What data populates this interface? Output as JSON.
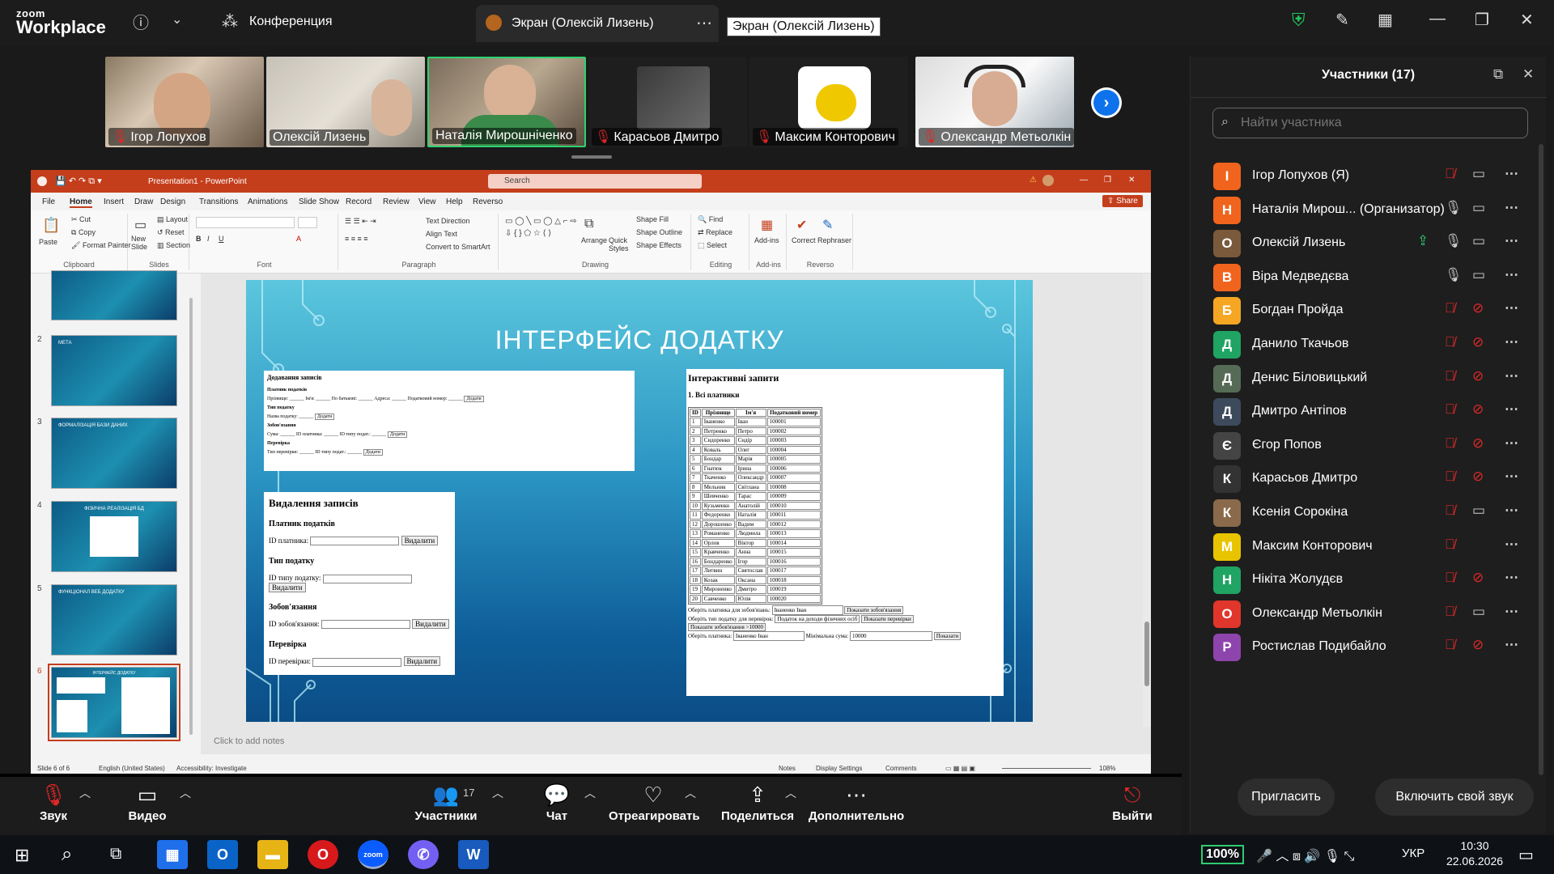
{
  "zoom": {
    "logo": {
      "line1": "zoom",
      "line2": "Workplace"
    },
    "meeting_title": "Конференция",
    "share_tab": "Экран (Олексій Лизень)",
    "tooltip": "Экран (Олексій Лизень)"
  },
  "video_tiles": [
    {
      "name": "Ігор Лопухов",
      "muted": true
    },
    {
      "name": "Олексій Лизень",
      "muted": false
    },
    {
      "name": "Наталія Мирошніченко",
      "muted": false,
      "active": true
    },
    {
      "name": "Карасьов Дмитро",
      "muted": true
    },
    {
      "name": "Максим Конторович",
      "muted": true
    },
    {
      "name": "Олександр Метьолкін",
      "muted": true
    }
  ],
  "ppt": {
    "window_title": "Presentation1 - PowerPoint",
    "search_placeholder": "Search",
    "menu": [
      "File",
      "Home",
      "Insert",
      "Draw",
      "Design",
      "Transitions",
      "Animations",
      "Slide Show",
      "Record",
      "Review",
      "View",
      "Help",
      "Reverso"
    ],
    "share_label": "Share",
    "ribbon": {
      "paste": "Paste",
      "cut": "Cut",
      "copy": "Copy",
      "format_painter": "Format Painter",
      "clipboard": "Clipboard",
      "new_slide": "New Slide",
      "layout": "Layout",
      "reset": "Reset",
      "section": "Section",
      "slides": "Slides",
      "font": "Font",
      "text_direction": "Text Direction",
      "align_text": "Align Text",
      "convert_smartart": "Convert to SmartArt",
      "paragraph": "Paragraph",
      "arrange": "Arrange",
      "quick_styles": "Quick Styles",
      "shape_fill": "Shape Fill",
      "shape_outline": "Shape Outline",
      "shape_effects": "Shape Effects",
      "drawing": "Drawing",
      "find": "Find",
      "replace": "Replace",
      "select": "Select",
      "editing": "Editing",
      "addins": "Add-ins",
      "addins_group": "Add-ins",
      "correct": "Correct",
      "rephraser": "Rephraser",
      "reverso_group": "Reverso"
    },
    "slides": [
      {
        "num": "2",
        "title": "МЕТА"
      },
      {
        "num": "3",
        "title": "ФОРМАЛІЗАЦІЯ БАЗИ ДАНИХ"
      },
      {
        "num": "4",
        "title": "ФІЗИЧНА РЕАЛІЗАЦІЯ БД"
      },
      {
        "num": "5",
        "title": "ФУНКЦІОНАЛ ВЕБ ДОДАТКУ"
      },
      {
        "num": "6",
        "title": "ІНТЕРФЕЙС ДОДАТКУ",
        "selected": true
      }
    ],
    "slide": {
      "title": "ІНТЕРФЕЙС ДОДАТКУ",
      "add_panel": {
        "heading": "Додавання записів",
        "payer": "Платник податків",
        "payer_fields": "Прізвище: ______ Ім'я: ______ По батькові: ______ Адреса: ______ Податковий номер: ______",
        "add_btn": "Додати",
        "tax_type": "Тип податку",
        "tax_field": "Назва податку:",
        "obligation": "Зобов'язання",
        "obligation_fields": "Сума: ______ ID платника: ______ ID типу подат.: ______",
        "check": "Перевірка",
        "check_fields": "Тип перевірки: ______ ID типу подат.: ______"
      },
      "delete_panel": {
        "heading": "Видалення записів",
        "sections": [
          {
            "title": "Платник податків",
            "label": "ID платника:",
            "button": "Видалити"
          },
          {
            "title": "Тип податку",
            "label": "ID типу податку:",
            "button": "Видалити"
          },
          {
            "title": "Зобов'язання",
            "label": "ID зобов'язання:",
            "button": "Видалити"
          },
          {
            "title": "Перевірка",
            "label": "ID перевірки:",
            "button": "Видалити"
          }
        ]
      },
      "query_panel": {
        "heading": "Інтерактивні запити",
        "subheading": "1. Всі платники",
        "columns": [
          "ID",
          "Прізвище",
          "Ім'я",
          "Податковий номер"
        ],
        "rows": [
          [
            "1",
            "Іваненко",
            "Іван",
            "100001"
          ],
          [
            "2",
            "Петренко",
            "Петро",
            "100002"
          ],
          [
            "3",
            "Сидоренко",
            "Сидір",
            "100003"
          ],
          [
            "4",
            "Коваль",
            "Олег",
            "100004"
          ],
          [
            "5",
            "Бондар",
            "Марія",
            "100005"
          ],
          [
            "6",
            "Гнатюк",
            "Ірина",
            "100006"
          ],
          [
            "7",
            "Ткаченко",
            "Олександр",
            "100007"
          ],
          [
            "8",
            "Мельник",
            "Світлана",
            "100008"
          ],
          [
            "9",
            "Шевченко",
            "Тарас",
            "100009"
          ],
          [
            "10",
            "Кузьменко",
            "Анатолій",
            "100010"
          ],
          [
            "11",
            "Федоренко",
            "Наталія",
            "100011"
          ],
          [
            "12",
            "Дорошенко",
            "Вадим",
            "100012"
          ],
          [
            "13",
            "Романенко",
            "Людмила",
            "100013"
          ],
          [
            "14",
            "Орлов",
            "Віктор",
            "100014"
          ],
          [
            "15",
            "Кравченко",
            "Анна",
            "100015"
          ],
          [
            "16",
            "Бондаренко",
            "Ігор",
            "100016"
          ],
          [
            "17",
            "Литвин",
            "Святослав",
            "100017"
          ],
          [
            "18",
            "Козак",
            "Оксана",
            "100018"
          ],
          [
            "19",
            "Мироненко",
            "Дмитро",
            "100019"
          ],
          [
            "20",
            "Савченко",
            "Юлія",
            "100020"
          ]
        ],
        "f1_label": "Оберіть платника для зобов'язань:",
        "f1_value": "Іваненко Іван",
        "f1_btn": "Показати зобов'язання",
        "f2_label": "Оберіть тип податку для перевірок:",
        "f2_value": "Податок на доходи фізичних осіб",
        "f2_btn": "Показати перевірки",
        "f3_btn": "Показати зобов'язання >10000",
        "f4_label": "Оберіть платника:",
        "f4_value": "Іваненко Іван",
        "f4_min": "Мінімальна сума:",
        "f4_min_value": "10000",
        "f4_btn": "Показати"
      }
    },
    "notes_placeholder": "Click to add notes",
    "status": {
      "slide": "Slide 6 of 6",
      "lang": "English (United States)",
      "accessibility": "Accessibility: Investigate",
      "notes": "Notes",
      "display": "Display Settings",
      "comments": "Comments",
      "zoom": "108%"
    }
  },
  "participants": {
    "title": "Участники (17)",
    "search_placeholder": "Найти участника",
    "list": [
      {
        "initial": "І",
        "color": "#f0641e",
        "name": "Ігор Лопухов (Я)",
        "mic": "off",
        "cam": "on"
      },
      {
        "initial": "Н",
        "color": "#f0641e",
        "name": "Наталія Мирош... (Организатор)",
        "mic": "on",
        "cam": "on"
      },
      {
        "initial": "О",
        "color": "#7a5a3a",
        "name": "Олексій Лизень",
        "mic": "on",
        "cam": "on",
        "sharing": true
      },
      {
        "initial": "В",
        "color": "#f0641e",
        "name": "Віра Медведєва",
        "mic": "on",
        "cam": "on"
      },
      {
        "initial": "Б",
        "color": "#f5a623",
        "name": "Богдан Пройда",
        "mic": "off",
        "cam": "off"
      },
      {
        "initial": "Д",
        "color": "#1fa463",
        "name": "Данило Ткачьов",
        "mic": "off",
        "cam": "off"
      },
      {
        "initial": "Д",
        "color": "#556b55",
        "name": "Денис Біловицький",
        "mic": "off",
        "cam": "off"
      },
      {
        "initial": "Д",
        "color": "#3d4a5c",
        "name": "Дмитро Антіпов",
        "mic": "off",
        "cam": "off"
      },
      {
        "initial": "Є",
        "color": "#444",
        "name": "Єгор Попов",
        "mic": "off",
        "cam": "off"
      },
      {
        "initial": "К",
        "color": "#333",
        "name": "Карасьов Дмитро",
        "mic": "off",
        "cam": "off"
      },
      {
        "initial": "К",
        "color": "#8a6a4a",
        "name": "Ксенія Сорокіна",
        "mic": "off",
        "cam": "on"
      },
      {
        "initial": "М",
        "color": "#e8c400",
        "name": "Максим Конторович",
        "mic": "off",
        "cam": "none"
      },
      {
        "initial": "Н",
        "color": "#1fa463",
        "name": "Нікіта Жолудєв",
        "mic": "off",
        "cam": "off"
      },
      {
        "initial": "О",
        "color": "#e0362b",
        "name": "Олександр Метьолкін",
        "mic": "off",
        "cam": "on"
      },
      {
        "initial": "Р",
        "color": "#8e44ad",
        "name": "Ростислав Подибайло",
        "mic": "off",
        "cam": "off"
      }
    ],
    "invite": "Пригласить",
    "unmute_self": "Включить свой звук"
  },
  "toolbar": {
    "audio": "Звук",
    "video": "Видео",
    "participants": "Участники",
    "participants_count": "17",
    "chat": "Чат",
    "react": "Отреагировать",
    "share": "Поделиться",
    "more": "Дополнительно",
    "leave": "Выйти"
  },
  "taskbar": {
    "battery": "100%",
    "lang": "УКР",
    "time": "10:30",
    "date": "22.06.2026"
  }
}
